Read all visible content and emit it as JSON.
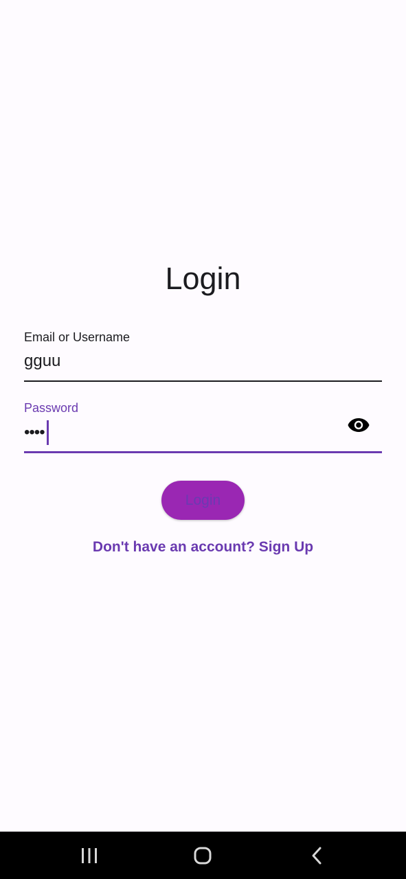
{
  "login": {
    "title": "Login",
    "email_label": "Email or Username",
    "email_value": "gguu",
    "password_label": "Password",
    "password_masked": "••••",
    "login_button": "Login",
    "signup_link": "Don't have an account? Sign Up"
  },
  "icons": {
    "visibility": "visibility-icon",
    "recents": "recent-apps-icon",
    "home": "home-icon",
    "back": "back-icon"
  },
  "colors": {
    "accent": "#6a3ab0",
    "button_fill": "#9a27b3",
    "background": "#fefbff",
    "nav_bar": "#000000"
  }
}
